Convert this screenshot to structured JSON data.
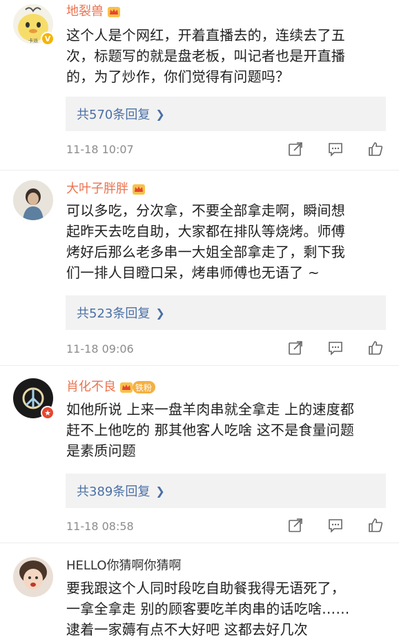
{
  "comments": [
    {
      "name": "地裂兽",
      "text_lines": [
        "这个人是个网红，开着直播去的，连续去了五",
        "次，标题写的就是盘老板，叫记者也是开直播",
        "的，为了炒作，你们觉得有问题吗？"
      ],
      "reply": "共570条回复",
      "time": "11-18 10:07",
      "badge": "V"
    },
    {
      "name": "大叶子胖胖",
      "text_lines": [
        "可以多吃，分次拿，不要全部拿走啊，瞬间想",
        "起昨天去吃自助，大家都在排队等烧烤。师傅",
        "烤好后那么老多串一大姐全部拿走了，剩下我",
        "们一排人目瞪口呆，烤串师傅也无语了 ~"
      ],
      "reply": "共523条回复",
      "time": "11-18 09:06"
    },
    {
      "name": "肖化不良",
      "fan_badge": "铁粉",
      "text_lines": [
        "如他所说 上来一盘羊肉串就全拿走 上的速度都",
        "赶不上他吃的 那其他客人吃啥 这不是食量问题",
        "是素质问题"
      ],
      "reply": "共389条回复",
      "time": "11-18 08:58",
      "badge": "★"
    },
    {
      "name": "HELLO你猜啊你猜啊",
      "text_lines": [
        "要我跟这个人同时段吃自助餐我得无语死了，",
        "一拿全拿走 别的顾客要吃羊肉串的话吃啥……",
        "逮着一家薅有点不大好吧 这都去好几次"
      ]
    }
  ],
  "icons": {
    "share": "share-icon",
    "comment": "comment-icon",
    "like": "like-icon",
    "crown": "crown-icon",
    "chevron": "chevron-right-icon"
  },
  "colors": {
    "name": "#eb7350",
    "link": "#4a6fa5",
    "reply_bg": "#f2f2f2",
    "meta": "#8c8c8c",
    "verified": "#f5b400",
    "badge_red": "#e8452f"
  }
}
